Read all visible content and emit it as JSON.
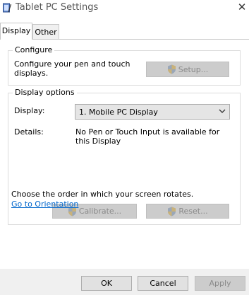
{
  "window": {
    "title": "Tablet PC Settings",
    "close_glyph": "✕"
  },
  "tabs": [
    {
      "label": "Display"
    },
    {
      "label": "Other"
    }
  ],
  "configure": {
    "group_title": "Configure",
    "description": "Configure your pen and touch displays.",
    "setup_label": "Setup..."
  },
  "display_options": {
    "group_title": "Display options",
    "display_label": "Display:",
    "display_value": "1. Mobile PC Display",
    "details_label": "Details:",
    "details_value": "No Pen or Touch Input is available for this Display",
    "calibrate_label": "Calibrate...",
    "reset_label": "Reset..."
  },
  "orientation": {
    "text": "Choose the order in which your screen rotates.",
    "link_label": "Go to Orientation"
  },
  "footer": {
    "ok_label": "OK",
    "cancel_label": "Cancel",
    "apply_label": "Apply"
  },
  "colors": {
    "link": "#0066cc",
    "disabled_button": "#cccccc",
    "footer_bg": "#f0f0f0"
  },
  "icons": {
    "app": "tablet-pc-icon",
    "shield": "uac-shield-icon",
    "dropdown": "chevron-down-icon"
  }
}
